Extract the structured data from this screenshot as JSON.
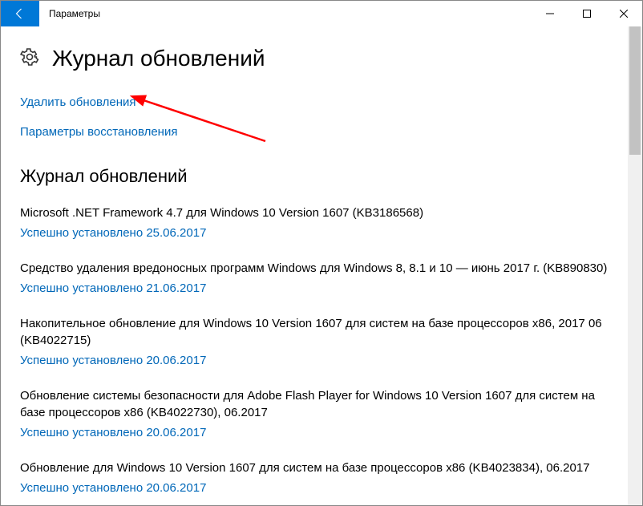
{
  "window": {
    "title": "Параметры"
  },
  "page": {
    "heading": "Журнал обновлений"
  },
  "links": {
    "uninstall": "Удалить обновления",
    "recovery": "Параметры восстановления"
  },
  "section_heading": "Журнал обновлений",
  "updates": [
    {
      "title": "Microsoft .NET Framework 4.7 для Windows 10 Version 1607 (KB3186568)",
      "status": "Успешно установлено 25.06.2017"
    },
    {
      "title": "Средство удаления вредоносных программ Windows для Windows 8, 8.1 и 10 — июнь 2017 г. (KB890830)",
      "status": "Успешно установлено 21.06.2017"
    },
    {
      "title": "Накопительное обновление для Windows 10 Version 1607 для систем на базе процессоров x86, 2017 06 (KB4022715)",
      "status": "Успешно установлено 20.06.2017"
    },
    {
      "title": "Обновление системы безопасности для Adobe Flash Player for Windows 10 Version 1607 для систем на базе процессоров x86 (KB4022730), 06.2017",
      "status": "Успешно установлено 20.06.2017"
    },
    {
      "title": "Обновление для Windows 10 Version 1607 для систем на базе процессоров x86 (KB4023834), 06.2017",
      "status": "Успешно установлено 20.06.2017"
    }
  ]
}
